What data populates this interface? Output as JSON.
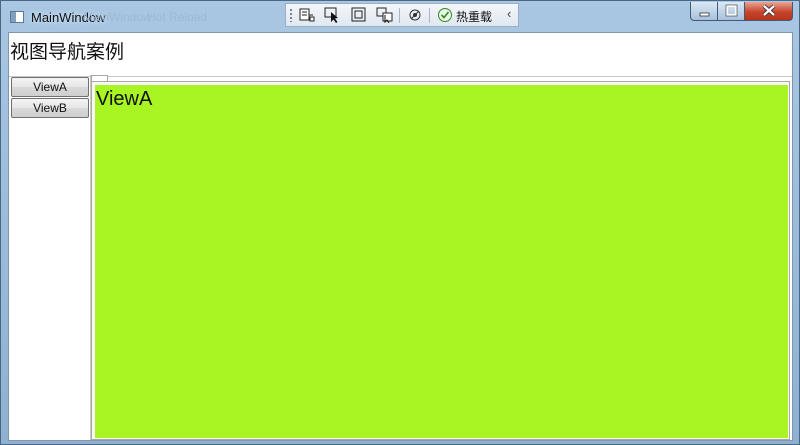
{
  "window": {
    "title": "MainWindow",
    "ghost_texts": [
      "MainWindow",
      "Hot Reload"
    ]
  },
  "debug_toolbar": {
    "buttons": [
      "visual-tree-icon",
      "select-element-icon",
      "display-layout-adorners-icon",
      "track-focused-element-icon",
      "binding-failures-icon"
    ],
    "hot_reload_label": "热重载"
  },
  "window_controls": [
    "minimize",
    "maximize",
    "close"
  ],
  "page": {
    "heading": "视图导航案例"
  },
  "nav": {
    "buttons": [
      {
        "label": "ViewA"
      },
      {
        "label": "ViewB"
      }
    ]
  },
  "content": {
    "active_view": "ViewA",
    "view_color": "#a8f523"
  }
}
